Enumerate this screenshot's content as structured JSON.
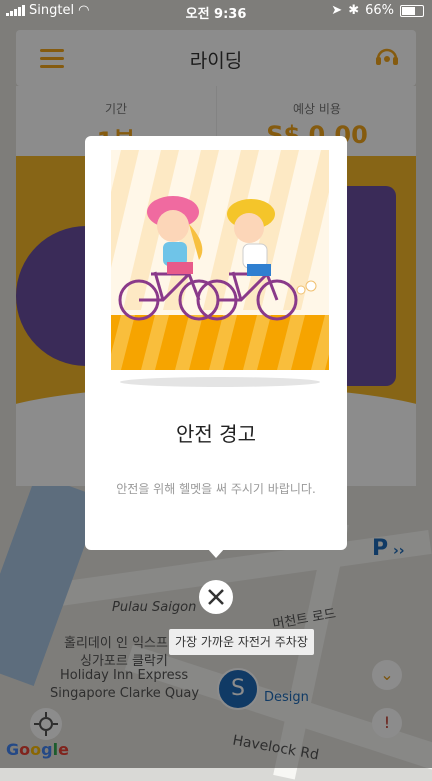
{
  "status_bar": {
    "carrier": "Singtel",
    "time": "오전 9:36",
    "battery": "66%"
  },
  "header": {
    "title": "라이딩"
  },
  "ride": {
    "duration_label": "기간",
    "duration_value": "1분",
    "cost_label": "예상 비용",
    "cost_value": "S$ 0.00"
  },
  "modal": {
    "title": "안전 경고",
    "message": "안전을 위해 헬멧을 써 주시기 바랍니다."
  },
  "tooltip": {
    "label": "가장 가까운 자전거 주차장"
  },
  "map": {
    "labels": [
      "Pulau Saigon",
      "홀리데이 인 익스프레스",
      "싱가포르 클락키",
      "Holiday Inn Express",
      "Singapore Clarke Quay",
      "머천트 로드",
      "Havelock Rd",
      "Design"
    ],
    "pin_letter": "S",
    "parking_letter": "P"
  },
  "colors": {
    "accent": "#f2a61d",
    "brand_blue": "#1e6bb8"
  },
  "icons": [
    "menu-icon",
    "support-headset-icon",
    "close-icon",
    "locate-icon"
  ]
}
